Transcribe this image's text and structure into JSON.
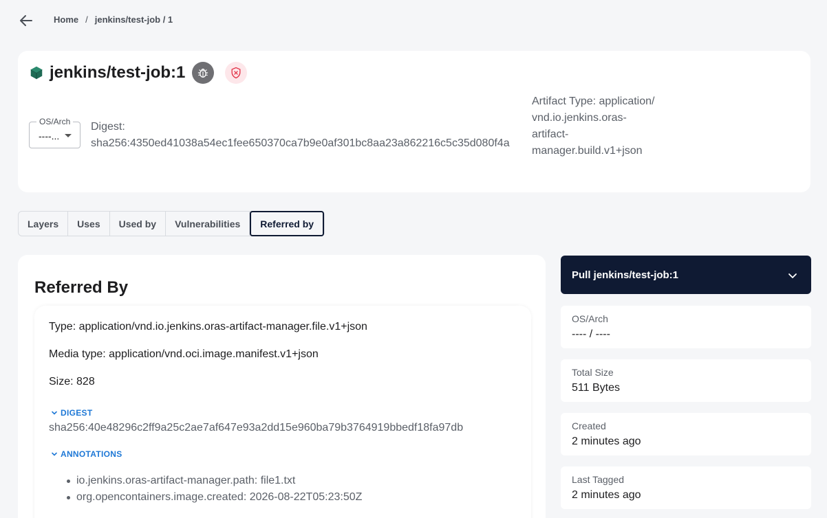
{
  "breadcrumb": {
    "home": "Home",
    "separator": "/",
    "current": "jenkins/test-job / 1"
  },
  "header": {
    "title": "jenkins/test-job:1",
    "os_arch_label": "OS/Arch",
    "os_arch_value": "----...",
    "digest_label": "Digest:",
    "digest_value": "sha256:4350ed41038a54ec1fee650370ca7b9e0af301bc8aa23a862216c5c35d080f4a",
    "artifact_type_text": "Artifact Type: application/ vnd.io.jenkins.oras-artifact-manager.build.v1+json"
  },
  "tabs": [
    {
      "label": "Layers"
    },
    {
      "label": "Uses"
    },
    {
      "label": "Used by"
    },
    {
      "label": "Vulnerabilities"
    },
    {
      "label": "Referred by",
      "active": true
    }
  ],
  "referred": {
    "title": "Referred By",
    "type": "Type: application/vnd.io.jenkins.oras-artifact-manager.file.v1+json",
    "media_type": "Media type: application/vnd.oci.image.manifest.v1+json",
    "size": "Size: 828",
    "digest_header": "DIGEST",
    "digest": "sha256:40e48296c2ff9a25c2ae7af647e93a2dd15e960ba79b3764919bbedf18fa97db",
    "annotations_header": "ANNOTATIONS",
    "annotations": [
      "io.jenkins.oras-artifact-manager.path: file1.txt",
      "org.opencontainers.image.created: 2026-08-22T05:23:50Z"
    ]
  },
  "pull": {
    "label": "Pull jenkins/test-job:1"
  },
  "info": {
    "os_arch": {
      "label": "OS/Arch",
      "value": "---- / ----"
    },
    "total_size": {
      "label": "Total Size",
      "value": "511 Bytes"
    },
    "created": {
      "label": "Created",
      "value": "2 minutes ago"
    },
    "last_tagged": {
      "label": "Last Tagged",
      "value": "2 minutes ago"
    }
  },
  "colors": {
    "accent_dark": "#0f1a33",
    "link_blue": "#1e78d6",
    "cube_green": "#1f6b55",
    "shield_red": "#e2364a"
  },
  "icons": [
    "back-arrow-icon",
    "cube-icon",
    "bug-icon",
    "shield-x-icon",
    "chevron-down-icon"
  ]
}
